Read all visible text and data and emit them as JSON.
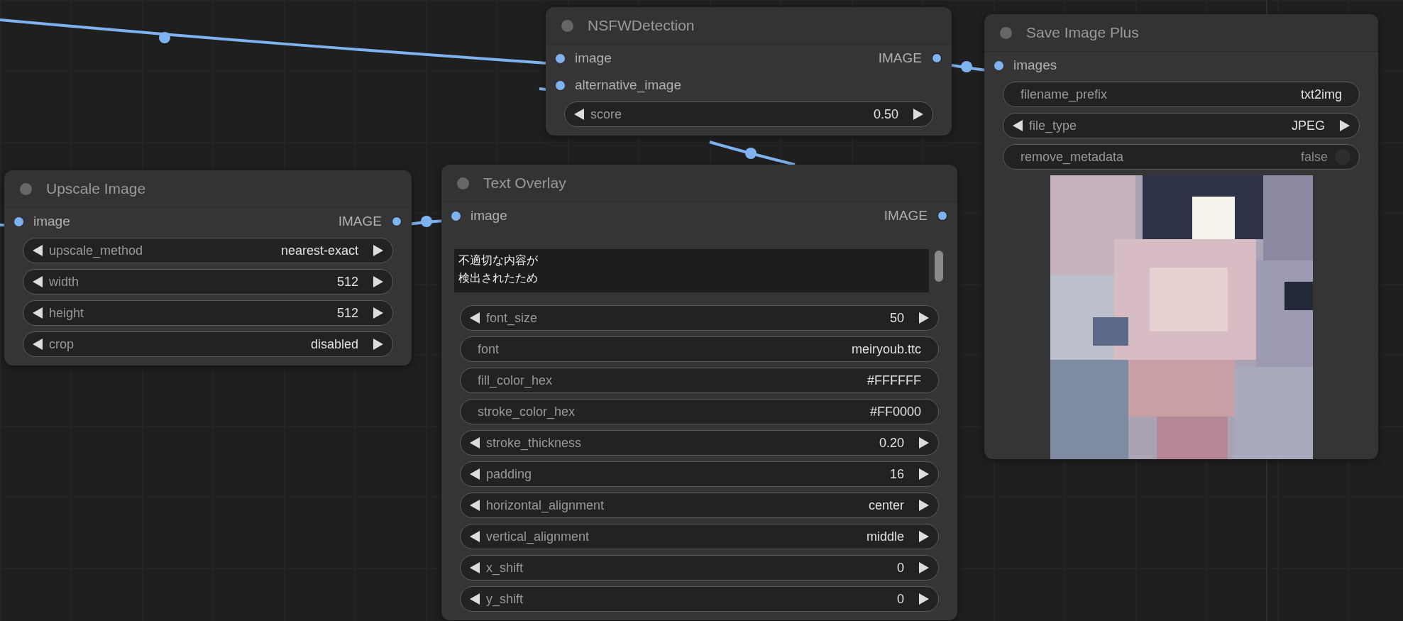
{
  "nodes": [
    {
      "title": "NSFWDetection",
      "inputs": [
        "image",
        "alternative_image"
      ],
      "outputs": [
        "IMAGE"
      ],
      "widgets": [
        {
          "kind": "stepper",
          "label": "score",
          "value": "0.50"
        }
      ]
    },
    {
      "title": "Save Image Plus",
      "inputs": [
        "images"
      ],
      "widgets": [
        {
          "kind": "text",
          "label": "filename_prefix",
          "value": "txt2img"
        },
        {
          "kind": "stepper",
          "label": "file_type",
          "value": "JPEG"
        },
        {
          "kind": "toggle",
          "label": "remove_metadata",
          "value": "false",
          "on": false
        }
      ],
      "preview": {
        "kind": "picture"
      }
    },
    {
      "title": "Upscale Image",
      "inputs": [
        "image"
      ],
      "outputs": [
        "IMAGE"
      ],
      "widgets": [
        {
          "kind": "stepper",
          "label": "upscale_method",
          "value": "nearest-exact"
        },
        {
          "kind": "stepper",
          "label": "width",
          "value": "512"
        },
        {
          "kind": "stepper",
          "label": "height",
          "value": "512"
        },
        {
          "kind": "stepper",
          "label": "crop",
          "value": "disabled"
        }
      ]
    },
    {
      "title": "Text Overlay",
      "inputs": [
        "image"
      ],
      "outputs": [
        "IMAGE"
      ],
      "textarea": [
        "不適切な内容が",
        "検出されたため"
      ],
      "widgets": [
        {
          "kind": "stepper",
          "label": "font_size",
          "value": "50"
        },
        {
          "kind": "text",
          "label": "font",
          "value": "meiryoub.ttc"
        },
        {
          "kind": "text",
          "label": "fill_color_hex",
          "value": "#FFFFFF"
        },
        {
          "kind": "text",
          "label": "stroke_color_hex",
          "value": "#FF0000"
        },
        {
          "kind": "stepper",
          "label": "stroke_thickness",
          "value": "0.20"
        },
        {
          "kind": "stepper",
          "label": "padding",
          "value": "16"
        },
        {
          "kind": "stepper",
          "label": "horizontal_alignment",
          "value": "center"
        },
        {
          "kind": "stepper",
          "label": "vertical_alignment",
          "value": "middle"
        },
        {
          "kind": "stepper",
          "label": "x_shift",
          "value": "0"
        },
        {
          "kind": "stepper",
          "label": "y_shift",
          "value": "0"
        }
      ]
    }
  ]
}
